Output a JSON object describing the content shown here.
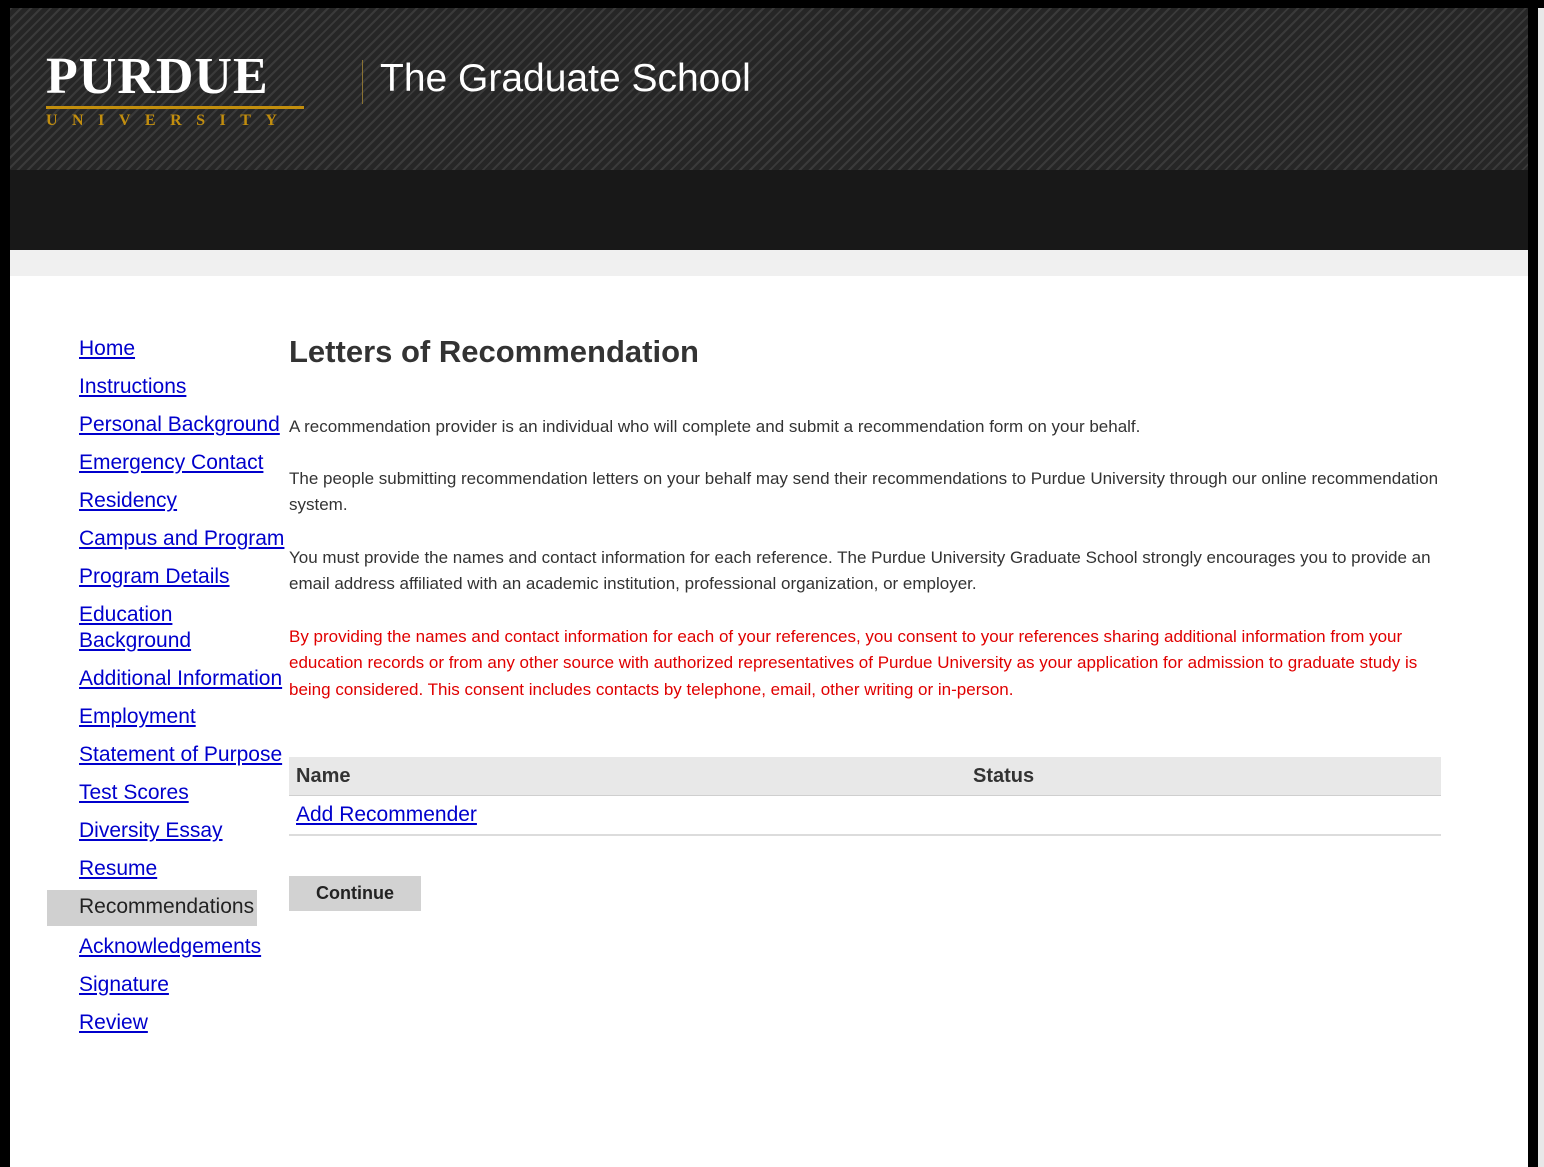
{
  "header": {
    "logo_word": "PURDUE",
    "logo_sub": "UNIVERSITY",
    "title": "The Graduate School"
  },
  "sidebar": {
    "items": [
      {
        "label": "Home"
      },
      {
        "label": "Instructions"
      },
      {
        "label": "Personal Background"
      },
      {
        "label": "Emergency Contact"
      },
      {
        "label": "Residency"
      },
      {
        "label": "Campus and Program"
      },
      {
        "label": "Program Details"
      },
      {
        "label": "Education Background"
      },
      {
        "label": "Additional Information"
      },
      {
        "label": "Employment"
      },
      {
        "label": "Statement of Purpose"
      },
      {
        "label": "Test Scores"
      },
      {
        "label": "Diversity Essay"
      },
      {
        "label": "Resume"
      },
      {
        "label": "Recommendations"
      },
      {
        "label": "Acknowledgements"
      },
      {
        "label": "Signature"
      },
      {
        "label": "Review"
      }
    ],
    "active": "Recommendations"
  },
  "main": {
    "title": "Letters of Recommendation",
    "paragraphs": [
      "A recommendation provider is an individual who will complete and submit a recommendation form on your behalf.",
      "The people submitting recommendation letters on your behalf may send their recommendations to Purdue University through our online recommendation system.",
      "You must provide the names and contact information for each reference. The Purdue University Graduate School strongly encourages you to provide an email address affiliated with an academic institution, professional organization, or employer.",
      "By providing the names and contact information for each of your references, you consent to your references sharing additional information from your education records or from any other source with authorized representatives of Purdue University as your application for admission to graduate study is being considered. This consent includes contacts by telephone, email, other writing or in-person."
    ],
    "table": {
      "headers": [
        "Name",
        "Status"
      ],
      "add_link": "Add Recommender"
    },
    "continue_label": "Continue"
  },
  "colors": {
    "link": "#0000cc",
    "warning": "#e00000",
    "gold": "#c28e0e"
  }
}
